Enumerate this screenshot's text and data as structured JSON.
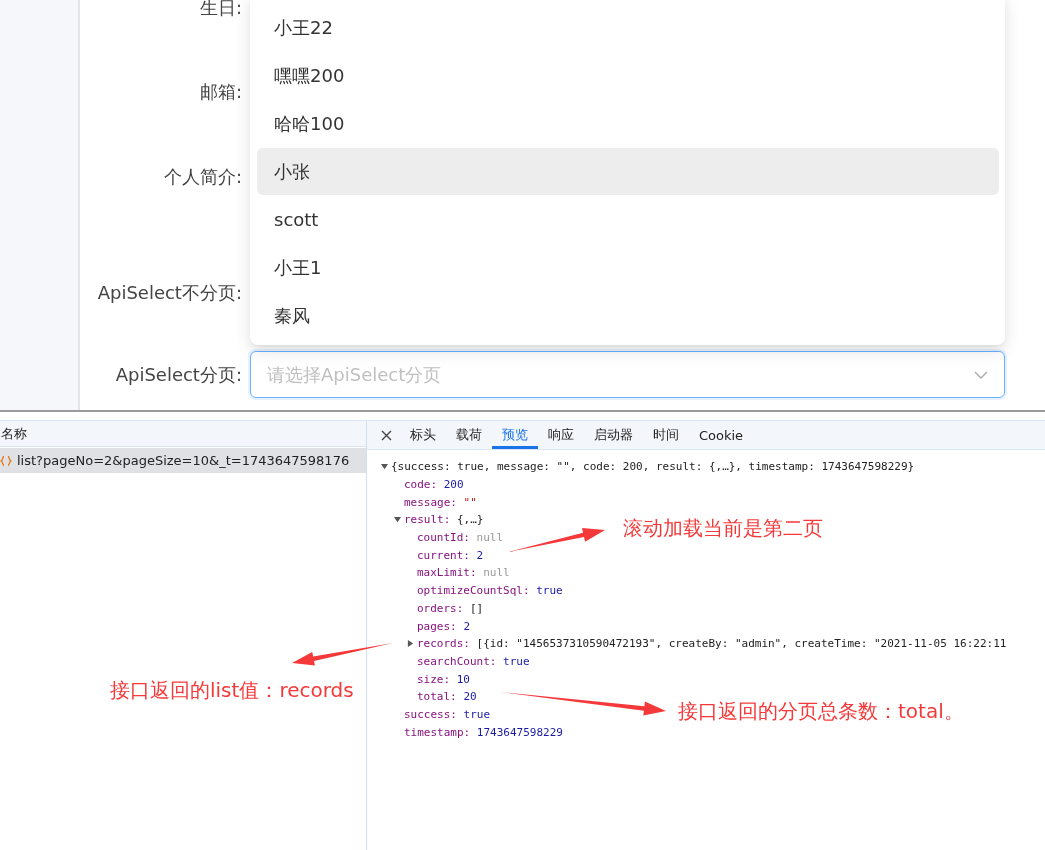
{
  "form": {
    "labels": [
      "生日:",
      "邮箱:",
      "个人简介:",
      "ApiSelect不分页:",
      "ApiSelect分页:"
    ],
    "dropdown_options": [
      {
        "label": "小王22",
        "selected": false
      },
      {
        "label": "嘿嘿200",
        "selected": false
      },
      {
        "label": "哈哈100",
        "selected": false
      },
      {
        "label": "小张",
        "selected": true
      },
      {
        "label": "scott",
        "selected": false
      },
      {
        "label": "小王1",
        "selected": false
      },
      {
        "label": "秦风",
        "selected": false
      }
    ],
    "select": {
      "placeholder": "请选择ApiSelect分页"
    }
  },
  "devtools": {
    "name_column": "名称",
    "requests": [
      {
        "name": "list?pageNo=2&pageSize=10&_t=1743647598176",
        "selected": true
      }
    ],
    "tabs": [
      {
        "label": "标头",
        "selected": false
      },
      {
        "label": "载荷",
        "selected": false
      },
      {
        "label": "预览",
        "selected": true
      },
      {
        "label": "响应",
        "selected": false
      },
      {
        "label": "启动器",
        "selected": false
      },
      {
        "label": "时间",
        "selected": false
      },
      {
        "label": "Cookie",
        "selected": false
      }
    ],
    "preview": [
      {
        "value": "{success: true, message: \"\", code: 200, result: {,…}, timestamp: 1743647598229}",
        "kind": "summary",
        "expanded": true,
        "children": [
          {
            "key": "code:",
            "value": "200",
            "kind": "number"
          },
          {
            "key": "message:",
            "value": "\"\"",
            "kind": "string"
          },
          {
            "key": "result:",
            "value": "{,…}",
            "kind": "summary",
            "expanded": true,
            "children": [
              {
                "key": "countId:",
                "value": "null",
                "kind": "null"
              },
              {
                "key": "current:",
                "value": "2",
                "kind": "number"
              },
              {
                "key": "maxLimit:",
                "value": "null",
                "kind": "null"
              },
              {
                "key": "optimizeCountSql:",
                "value": "true",
                "kind": "boolean"
              },
              {
                "key": "orders:",
                "value": "[]",
                "kind": "summary"
              },
              {
                "key": "pages:",
                "value": "2",
                "kind": "number"
              },
              {
                "key": "records:",
                "value": "[{id: \"1456537310590472193\", createBy: \"admin\", createTime: \"2021-11-05 16:22:11",
                "kind": "summary",
                "expanded": false
              },
              {
                "key": "searchCount:",
                "value": "true",
                "kind": "boolean"
              },
              {
                "key": "size:",
                "value": "10",
                "kind": "number"
              },
              {
                "key": "total:",
                "value": "20",
                "kind": "number"
              }
            ]
          },
          {
            "key": "success:",
            "value": "true",
            "kind": "boolean"
          },
          {
            "key": "timestamp:",
            "value": "1743647598229",
            "kind": "number"
          }
        ]
      }
    ]
  },
  "annotations": [
    "滚动加载当前是第二页",
    "接口返回的list值：records",
    "接口返回的分页总条数：total。"
  ]
}
